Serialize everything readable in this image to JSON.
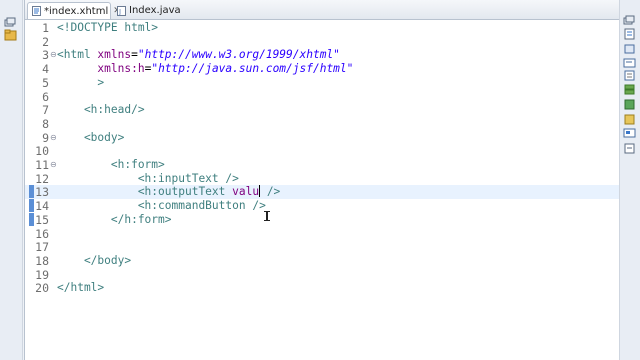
{
  "tabs": [
    {
      "label": "*index.xhtml",
      "close": "✕",
      "active": true
    },
    {
      "label": "Index.java",
      "active": false
    }
  ],
  "editor": {
    "current_line": 13,
    "lines": [
      {
        "n": "1",
        "fold": "",
        "tokens": [
          {
            "c": "tag",
            "t": "<!DOCTYPE html>"
          }
        ]
      },
      {
        "n": "2",
        "fold": "",
        "tokens": []
      },
      {
        "n": "3",
        "fold": "⊖",
        "tokens": [
          {
            "c": "tag",
            "t": "<html "
          },
          {
            "c": "attr",
            "t": "xmlns"
          },
          {
            "c": "plain",
            "t": "="
          },
          {
            "c": "str",
            "t": "\"http://www.w3.org/1999/xhtml\""
          }
        ]
      },
      {
        "n": "4",
        "fold": "",
        "tokens": [
          {
            "c": "plain",
            "t": "      "
          },
          {
            "c": "attr",
            "t": "xmlns:h"
          },
          {
            "c": "plain",
            "t": "="
          },
          {
            "c": "str",
            "t": "\"http://java.sun.com/jsf/html\""
          }
        ]
      },
      {
        "n": "5",
        "fold": "",
        "tokens": [
          {
            "c": "tag",
            "t": "      >"
          }
        ]
      },
      {
        "n": "6",
        "fold": "",
        "tokens": []
      },
      {
        "n": "7",
        "fold": "",
        "tokens": [
          {
            "c": "tag",
            "t": "    <h:head/>"
          }
        ]
      },
      {
        "n": "8",
        "fold": "",
        "tokens": []
      },
      {
        "n": "9",
        "fold": "⊖",
        "tokens": [
          {
            "c": "tag",
            "t": "    <body>"
          }
        ]
      },
      {
        "n": "10",
        "fold": "",
        "tokens": []
      },
      {
        "n": "11",
        "fold": "⊖",
        "tokens": [
          {
            "c": "tag",
            "t": "        <h:form>"
          }
        ]
      },
      {
        "n": "12",
        "fold": "",
        "tokens": [
          {
            "c": "tag",
            "t": "            <h:inputText />"
          }
        ]
      },
      {
        "n": "13",
        "fold": "",
        "tokens": [
          {
            "c": "tag",
            "t": "            <h:outputText "
          },
          {
            "c": "attr",
            "t": "valu"
          },
          {
            "c": "caret",
            "t": ""
          },
          {
            "c": "tag",
            "t": " />"
          }
        ]
      },
      {
        "n": "14",
        "fold": "",
        "tokens": [
          {
            "c": "tag",
            "t": "            <h:commandButton />"
          }
        ]
      },
      {
        "n": "15",
        "fold": "",
        "tokens": [
          {
            "c": "tag",
            "t": "        </h:form>"
          }
        ]
      },
      {
        "n": "16",
        "fold": "",
        "tokens": []
      },
      {
        "n": "17",
        "fold": "",
        "tokens": []
      },
      {
        "n": "18",
        "fold": "",
        "tokens": [
          {
            "c": "tag",
            "t": "    </body>"
          }
        ]
      },
      {
        "n": "19",
        "fold": "",
        "tokens": []
      },
      {
        "n": "20",
        "fold": "",
        "tokens": [
          {
            "c": "tag",
            "t": "</html>"
          }
        ]
      }
    ],
    "changed_lines": [
      13,
      14,
      15
    ]
  },
  "colors": {
    "tag": "#3f7f7f",
    "attribute": "#7f007f",
    "string": "#2a00ff",
    "current_line": "#e8f2fe",
    "change_marker": "#5b8fd6"
  },
  "icons": {
    "left_trim": [
      "restore-icon",
      "package-explorer-icon"
    ],
    "right_trim": [
      "restore-icon",
      "outline-icon",
      "task-list-icon",
      "console-icon",
      "properties-icon",
      "servers-icon",
      "data-source-icon",
      "snippets-icon",
      "palette-icon",
      "markers-icon"
    ]
  }
}
